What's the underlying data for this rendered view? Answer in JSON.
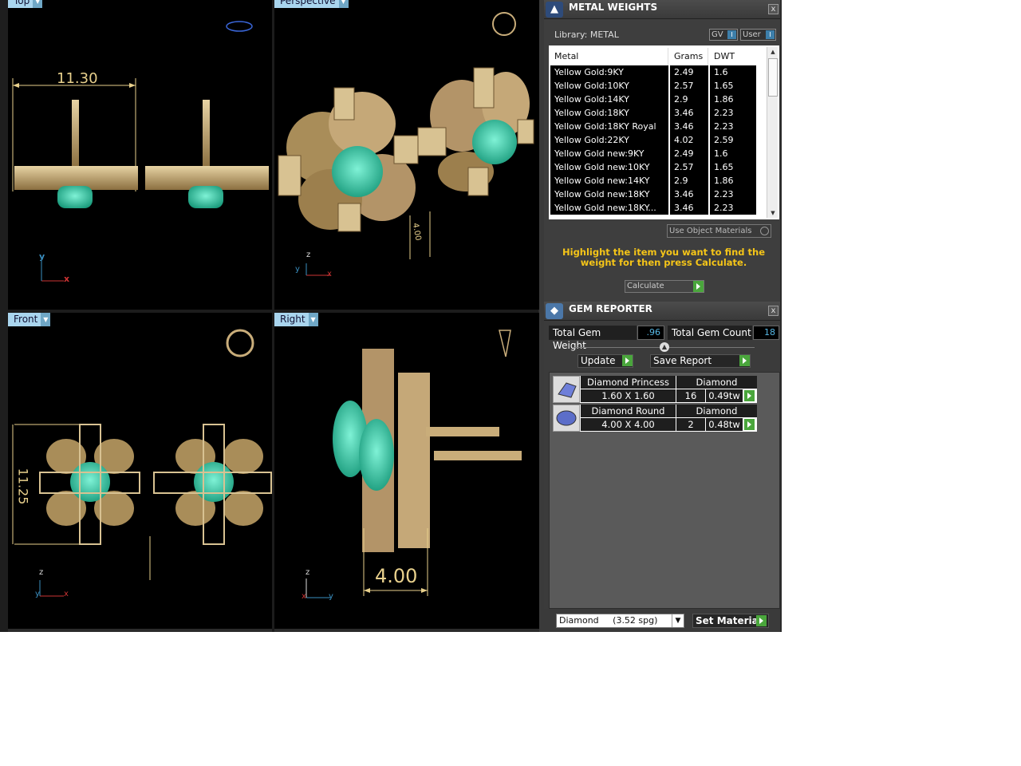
{
  "viewports": {
    "top": {
      "label": "Top",
      "dimension": "11.30",
      "axis_a": "y",
      "axis_b": "x"
    },
    "perspective": {
      "label": "Perspective",
      "dimension": "4.00",
      "axis_a": "z",
      "axis_b": "x",
      "axis_c": "y"
    },
    "front": {
      "label": "Front",
      "dimension": "11.25",
      "axis_a": "z",
      "axis_b": "x",
      "axis_c": "y"
    },
    "right": {
      "label": "Right",
      "dimension": "4.00",
      "axis_a": "z",
      "axis_b": "y",
      "axis_c": "x"
    }
  },
  "metal_panel": {
    "title": "METAL WEIGHTS",
    "close": "x",
    "library": "Library: METAL",
    "toggle_gv": "GV",
    "toggle_user": "User",
    "toggle_indicator": "I",
    "headers": {
      "metal": "Metal",
      "grams": "Grams",
      "dwt": "DWT"
    },
    "rows": [
      {
        "metal": "Yellow Gold:9KY",
        "grams": "2.49",
        "dwt": "1.6"
      },
      {
        "metal": "Yellow Gold:10KY",
        "grams": "2.57",
        "dwt": "1.65"
      },
      {
        "metal": "Yellow Gold:14KY",
        "grams": "2.9",
        "dwt": "1.86"
      },
      {
        "metal": "Yellow Gold:18KY",
        "grams": "3.46",
        "dwt": "2.23"
      },
      {
        "metal": "Yellow Gold:18KY Royal",
        "grams": "3.46",
        "dwt": "2.23"
      },
      {
        "metal": "Yellow Gold:22KY",
        "grams": "4.02",
        "dwt": "2.59"
      },
      {
        "metal": "Yellow Gold new:9KY",
        "grams": "2.49",
        "dwt": "1.6"
      },
      {
        "metal": "Yellow Gold new:10KY",
        "grams": "2.57",
        "dwt": "1.65"
      },
      {
        "metal": "Yellow Gold new:14KY",
        "grams": "2.9",
        "dwt": "1.86"
      },
      {
        "metal": "Yellow Gold new:18KY",
        "grams": "3.46",
        "dwt": "2.23"
      },
      {
        "metal": "Yellow Gold new:18KY...",
        "grams": "3.46",
        "dwt": "2.23"
      }
    ],
    "use_object_materials": "Use Object Materials",
    "hint": "Highlight the item you want to find the weight for then press Calculate.",
    "calculate": "Calculate"
  },
  "gem_panel": {
    "title": "GEM REPORTER",
    "close": "x",
    "total_weight_label": "Total Gem Weight",
    "total_weight_value": ".96",
    "total_count_label": "Total Gem Count",
    "total_count_value": "18",
    "update": "Update",
    "save_report": "Save Report",
    "gems": [
      {
        "name": "Diamond Princess",
        "type": "Diamond",
        "size": "1.60 X 1.60",
        "count": "16",
        "weight": "0.49tw"
      },
      {
        "name": "Diamond Round",
        "type": "Diamond",
        "size": "4.00 X 4.00",
        "count": "2",
        "weight": "0.48tw"
      }
    ],
    "material_select": "Diamond     (3.52 spg)",
    "set_material": "Set Material"
  },
  "colors": {
    "gold": "#c9ad7a",
    "gem": "#3fcfa8",
    "dimension": "#e8d08c",
    "viewport_bg": "#000000",
    "tab": "#a9d5ee",
    "hint": "#f5c518",
    "go_button": "#4aa63c"
  }
}
